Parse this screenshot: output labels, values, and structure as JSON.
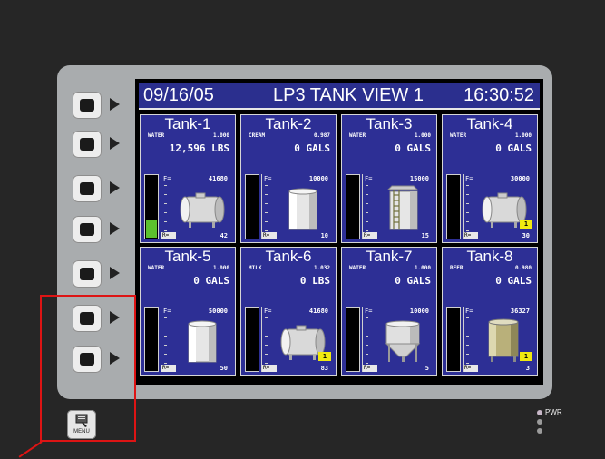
{
  "header": {
    "date": "09/16/05",
    "title": "LP3 TANK VIEW 1",
    "time": "16:30:52"
  },
  "tiles": [
    {
      "name": "Tank-1",
      "product": "WATER",
      "factor": "1.000",
      "amount": "12,596 LBS",
      "f_label": "F=",
      "f_value": "41680",
      "r_label": "R=",
      "r_value": "42",
      "level": 0.3,
      "tank": "horizontal-tank-icon",
      "flag": ""
    },
    {
      "name": "Tank-2",
      "product": "CREAM",
      "factor": "0.987",
      "amount": "0 GALS",
      "f_label": "F=",
      "f_value": "10000",
      "r_label": "R=",
      "r_value": "10",
      "level": 0,
      "tank": "vertical-tank-icon",
      "flag": ""
    },
    {
      "name": "Tank-3",
      "product": "WATER",
      "factor": "1.000",
      "amount": "0 GALS",
      "f_label": "F=",
      "f_value": "15000",
      "r_label": "R=",
      "r_value": "15",
      "level": 0,
      "tank": "ladder-tank-icon",
      "flag": ""
    },
    {
      "name": "Tank-4",
      "product": "WATER",
      "factor": "1.000",
      "amount": "0 GALS",
      "f_label": "F=",
      "f_value": "30000",
      "r_label": "R=",
      "r_value": "30",
      "level": 0,
      "tank": "horizontal-tank-icon",
      "flag": "1"
    },
    {
      "name": "Tank-5",
      "product": "WATER",
      "factor": "1.000",
      "amount": "0 GALS",
      "f_label": "F=",
      "f_value": "50000",
      "r_label": "R=",
      "r_value": "50",
      "level": 0,
      "tank": "vertical-tank-icon",
      "flag": ""
    },
    {
      "name": "Tank-6",
      "product": "MILK",
      "factor": "1.032",
      "amount": "0 LBS",
      "f_label": "F=",
      "f_value": "41680",
      "r_label": "R=",
      "r_value": "83",
      "level": 0,
      "tank": "horizontal-tank-icon",
      "flag": "1"
    },
    {
      "name": "Tank-7",
      "product": "WATER",
      "factor": "1.000",
      "amount": "0 GALS",
      "f_label": "F=",
      "f_value": "10000",
      "r_label": "R=",
      "r_value": "5",
      "level": 0,
      "tank": "cone-tank-icon",
      "flag": ""
    },
    {
      "name": "Tank-8",
      "product": "BEER",
      "factor": "0.980",
      "amount": "0 GALS",
      "f_label": "F=",
      "f_value": "36327",
      "r_label": "R=",
      "r_value": "3",
      "level": 0,
      "tank": "fermenter-tank-icon",
      "flag": "1"
    }
  ],
  "menu_label": "MENU",
  "pwr_label": "PWR",
  "colors": {
    "panel": "#2d2f95",
    "header": "#2b2f8e",
    "level_fill": "#5cc12e",
    "flag": "#f1ea10",
    "highlight": "#dd1414"
  }
}
